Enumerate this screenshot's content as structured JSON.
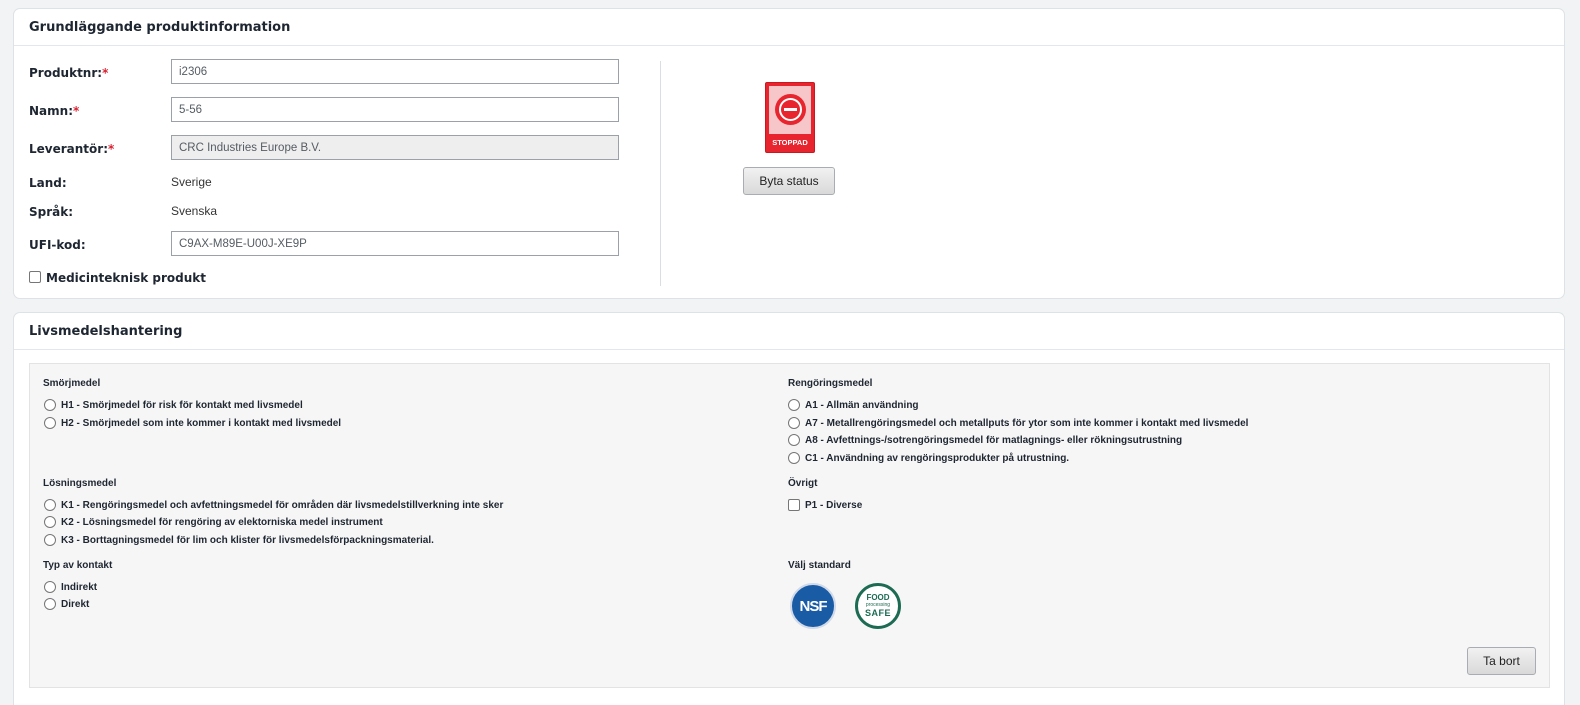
{
  "basic_info": {
    "title": "Grundläggande produktinformation",
    "fields": {
      "produktnr": {
        "label": "Produktnr:",
        "required_mark": "*",
        "value": "i2306"
      },
      "namn": {
        "label": "Namn:",
        "required_mark": "*",
        "value": "5-56"
      },
      "leverantor": {
        "label": "Leverantör:",
        "required_mark": "*",
        "value": "CRC Industries Europe B.V."
      },
      "land": {
        "label": "Land:",
        "value": "Sverige"
      },
      "sprak": {
        "label": "Språk:",
        "value": "Svenska"
      },
      "ufi": {
        "label": "UFI-kod:",
        "value": "C9AX-M89E-U00J-XE9P"
      }
    },
    "medicinteknisk": {
      "label": "Medicinteknisk produkt",
      "checked": false
    },
    "status": {
      "badge_text": "STOPPAD",
      "color": "#e8252e",
      "icon": "stop-icon"
    },
    "change_status_button": "Byta status"
  },
  "food_handling": {
    "title": "Livsmedelshantering",
    "groups": {
      "smorjmedel": {
        "title": "Smörjmedel",
        "options": [
          "H1 - Smörjmedel för risk för kontakt med livsmedel",
          "H2 - Smörjmedel som inte kommer i kontakt med livsmedel"
        ]
      },
      "rengoringsmedel": {
        "title": "Rengöringsmedel",
        "options": [
          "A1 - Allmän användning",
          "A7 - Metallrengöringsmedel och metallputs för ytor som inte kommer i kontakt med livsmedel",
          "A8 - Avfettnings-/sotrengöringsmedel för matlagnings- eller rökningsutrustning",
          "C1 - Användning av rengöringsprodukter på utrustning."
        ]
      },
      "losningsmedel": {
        "title": "Lösningsmedel",
        "options": [
          "K1 - Rengöringsmedel och avfettningsmedel för områden där livsmedelstillverkning inte sker",
          "K2 - Lösningsmedel för rengöring av elektorniska medel instrument",
          "K3 - Borttagningsmedel för lim och klister för livsmedelsförpackningsmaterial."
        ]
      },
      "ovrigt": {
        "title": "Övrigt",
        "options": [
          "P1 - Diverse"
        ]
      },
      "kontakt": {
        "title": "Typ av kontakt",
        "options": [
          "Indirekt",
          "Direkt"
        ]
      },
      "standard": {
        "title": "Välj standard",
        "logos": {
          "nsf": {
            "text": "NSF",
            "color": "#1a5ba6"
          },
          "food_safe": {
            "line1": "FOOD",
            "line2": "processing",
            "line3": "SAFE",
            "color": "#1d6b53"
          }
        }
      }
    },
    "remove_button": "Ta bort"
  }
}
